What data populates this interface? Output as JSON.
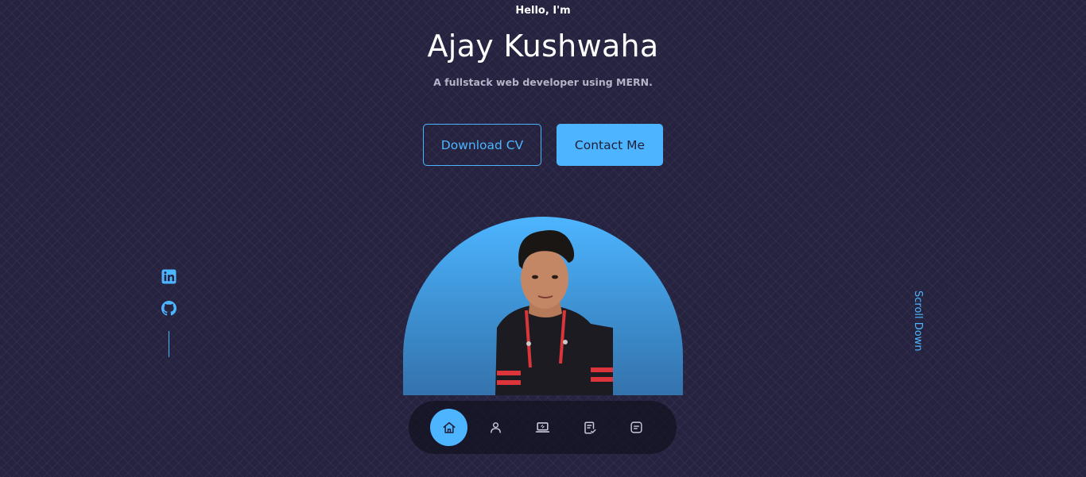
{
  "hero": {
    "greeting": "Hello, I'm",
    "name": "Ajay Kushwaha",
    "tagline": "A fullstack web developer using MERN."
  },
  "actions": {
    "download_cv_label": "Download CV",
    "contact_label": "Contact Me"
  },
  "socials": [
    {
      "icon": "linkedin-icon"
    },
    {
      "icon": "github-icon"
    }
  ],
  "scroll_down_label": "Scroll Down",
  "nav": {
    "items": [
      {
        "icon": "home-icon",
        "active": true
      },
      {
        "icon": "user-icon",
        "active": false
      },
      {
        "icon": "laptop-icon",
        "active": false
      },
      {
        "icon": "checklist-icon",
        "active": false
      },
      {
        "icon": "message-icon",
        "active": false
      }
    ]
  },
  "colors": {
    "accent": "#4db5ff",
    "background": "#25233f",
    "text_muted": "#b6b4c8",
    "nav_bg": "#1a1a2e"
  }
}
